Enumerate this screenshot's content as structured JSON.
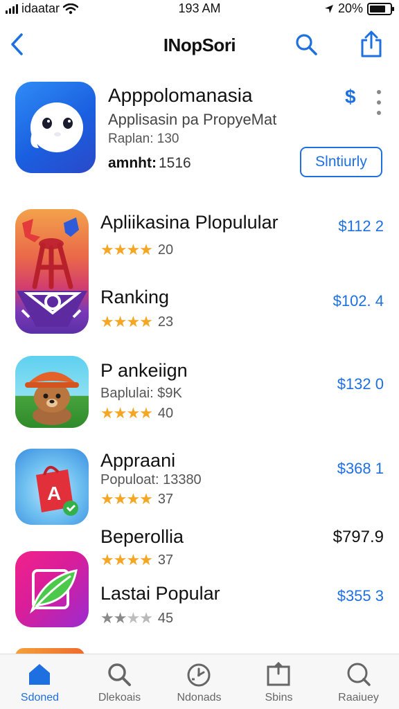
{
  "status_bar": {
    "carrier": "idaatar",
    "time": "193 AM",
    "battery": "20%",
    "battery_level": 0.8
  },
  "nav": {
    "title": "INopSori",
    "icons": [
      "back-chevron-icon",
      "search-icon",
      "share-icon"
    ]
  },
  "featured": {
    "title": "Apppolomanasia",
    "subtitle": "Applisasin pa PropyeMat",
    "rank_label": "Raplan:",
    "rank_value": "130",
    "download_label": "amnht:",
    "download_value": "1516",
    "price_symbol": "$",
    "button_label": "Slntiurly"
  },
  "apps": [
    {
      "name": "Apliikasina Plopulular",
      "rating": 4,
      "count": "20",
      "price": "$112 2"
    },
    {
      "name": "Ranking",
      "rating": 4,
      "count": "23",
      "price": "$102. 4"
    },
    {
      "name": "P ankeiign",
      "subtitle": "Baplulai: $9K",
      "rating": 4,
      "count": "40",
      "price": "$132 0"
    },
    {
      "name": "Appraani",
      "subtitle": "Populoat: 13380",
      "rating": 4,
      "count": "37",
      "price": "$368 1"
    },
    {
      "name": "Beperollia",
      "rating": 4,
      "count": "37",
      "price": "$797.9"
    },
    {
      "name": "Lastai Popular",
      "rating": 3,
      "count": "45",
      "price": "$355 3"
    }
  ],
  "tabs": [
    {
      "label": "Sdoned",
      "icon": "home-icon",
      "active": true
    },
    {
      "label": "Dlekoais",
      "icon": "search-icon",
      "active": false
    },
    {
      "label": "Ndonads",
      "icon": "timer-icon",
      "active": false
    },
    {
      "label": "Sbins",
      "icon": "box-icon",
      "active": false
    },
    {
      "label": "Raaiuey",
      "icon": "search-icon",
      "active": false
    }
  ],
  "colors": {
    "accent": "#1e6fe0",
    "star": "#f5a623",
    "star_empty": "#b9b9b9"
  }
}
